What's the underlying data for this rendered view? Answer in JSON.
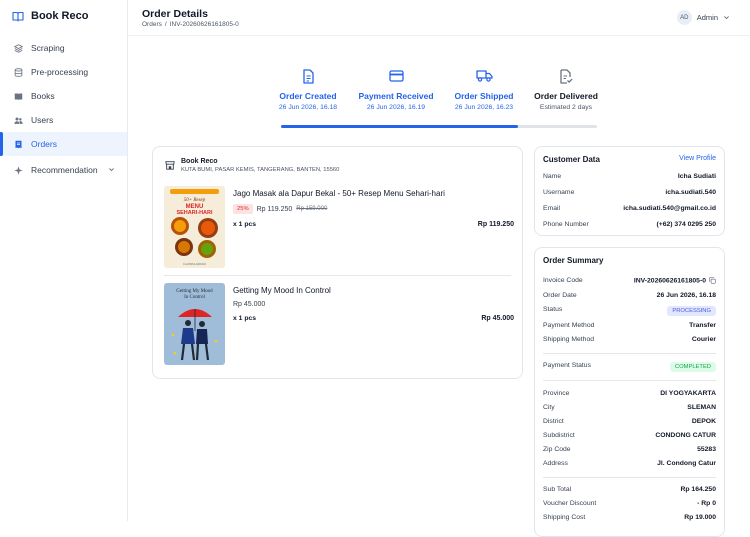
{
  "brand": {
    "name": "Book Reco"
  },
  "sidebar": {
    "items": [
      {
        "label": "Scraping",
        "icon": "layers-icon"
      },
      {
        "label": "Pre-processing",
        "icon": "database-icon"
      },
      {
        "label": "Books",
        "icon": "book-icon"
      },
      {
        "label": "Users",
        "icon": "users-icon"
      },
      {
        "label": "Orders",
        "icon": "receipt-icon",
        "active": true
      },
      {
        "label": "Recommendation",
        "icon": "sparkle-icon"
      }
    ]
  },
  "header": {
    "title": "Order Details",
    "breadcrumb": [
      "Orders",
      "/",
      "INV-20260626161805-0"
    ],
    "user": {
      "initials": "AD",
      "name": "Admin"
    }
  },
  "progress": {
    "percent": 75,
    "steps": [
      {
        "label": "Order Created",
        "sub": "26 Jun 2026, 16.18",
        "done": true
      },
      {
        "label": "Payment Received",
        "sub": "26 Jun 2026, 16.19",
        "done": true
      },
      {
        "label": "Order Shipped",
        "sub": "26 Jun 2026, 16.23",
        "done": true
      },
      {
        "label": "Order Delivered",
        "sub": "Estimated 2 days",
        "done": false
      }
    ]
  },
  "store": {
    "name": "Book Reco",
    "address": "KUTA BUMI, PASAR KEMIS, TANGERANG, BANTEN, 15560"
  },
  "items": [
    {
      "title": "Jago Masak ala Dapur Bekal - 50+ Resep Menu Sehari-hari",
      "discount": "25%",
      "price": "Rp 119.250",
      "original_price": "Rp 159.000",
      "qty": "x 1 pcs",
      "total": "Rp 119.250",
      "cover": {
        "line1": "50+ Resep",
        "line2": "MENU",
        "line3": "SEHARI-HARI",
        "author": "CLARISSA ADRIANI"
      }
    },
    {
      "title": "Getting My Mood In Control",
      "price": "Rp 45.000",
      "qty": "x 1 pcs",
      "total": "Rp 45.000",
      "cover": {
        "line1": "Getting My Mood",
        "line2": "In Control"
      }
    }
  ],
  "customer": {
    "title": "Customer Data",
    "view_profile": "View Profile",
    "rows": [
      {
        "label": "Name",
        "value": "Icha Sudiati"
      },
      {
        "label": "Username",
        "value": "icha.sudiati.540"
      },
      {
        "label": "Email",
        "value": "icha.sudiati.540@gmail.co.id"
      },
      {
        "label": "Phone Number",
        "value": "(+62) 374 0295 250"
      }
    ]
  },
  "summary": {
    "title": "Order Summary",
    "invoice_label": "Invoice Code",
    "invoice": "INV-20260626161805-0",
    "date_label": "Order Date",
    "date": "26 Jun 2026, 16.18",
    "status_label": "Status",
    "status": "PROCESSING",
    "pay_method_label": "Payment Method",
    "pay_method": "Transfer",
    "ship_method_label": "Shipping Method",
    "ship_method": "Courier",
    "pay_status_label": "Payment Status",
    "pay_status": "COMPLETED",
    "address": [
      {
        "label": "Province",
        "value": "DI YOGYAKARTA"
      },
      {
        "label": "City",
        "value": "SLEMAN"
      },
      {
        "label": "District",
        "value": "DEPOK"
      },
      {
        "label": "Subdistrict",
        "value": "CONDONG CATUR"
      },
      {
        "label": "Zip Code",
        "value": "55283"
      },
      {
        "label": "Address",
        "value": "Jl. Condong Catur"
      }
    ],
    "totals": [
      {
        "label": "Sub Total",
        "value": "Rp 164.250"
      },
      {
        "label": "Voucher Discount",
        "value": "- Rp 0"
      },
      {
        "label": "Shipping Cost",
        "value": "Rp 19.000"
      }
    ]
  },
  "colors": {
    "accent": "#2563eb",
    "processing": "#4f5bd5",
    "completed": "#16a34a"
  }
}
